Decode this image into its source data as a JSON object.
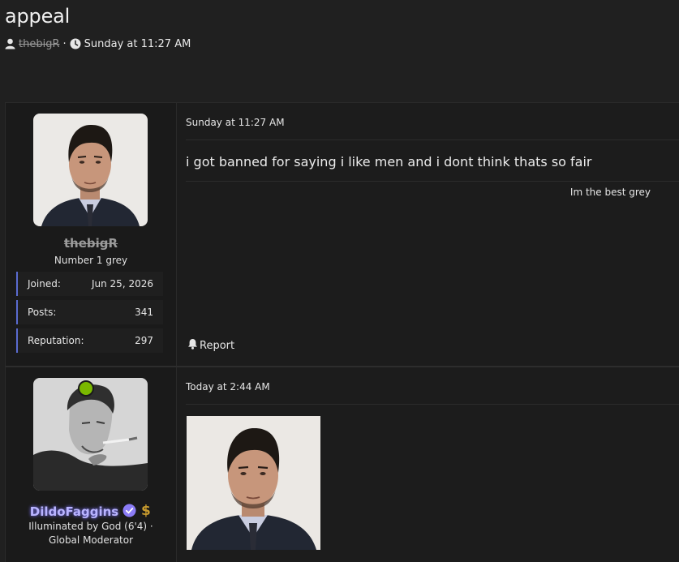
{
  "thread": {
    "title": "appeal",
    "author": "thebigR",
    "date": "Sunday at 11:27 AM"
  },
  "posts": [
    {
      "user": {
        "name": "thebigR",
        "title": "Number 1 grey",
        "stats": [
          {
            "label": "Joined:",
            "value": "Jun 25, 2026"
          },
          {
            "label": "Posts:",
            "value": "341"
          },
          {
            "label": "Reputation:",
            "value": "297"
          }
        ]
      },
      "date": "Sunday at 11:27 AM",
      "body": "i got banned for saying i like men and i dont think thats so fair",
      "signature": "Im the best grey",
      "report_label": "Report"
    },
    {
      "user": {
        "name": "DildoFaggins",
        "title_line1": "Illuminated by God (6'4) ·",
        "title_line2": "Global Moderator"
      },
      "date": "Today at 2:44 AM"
    }
  ],
  "colors": {
    "accent": "#5a6bd0",
    "online": "#7ab800",
    "moderator_name": "#b9b4ff",
    "verified": "#8b7cf6",
    "money": "#c79a2e"
  }
}
